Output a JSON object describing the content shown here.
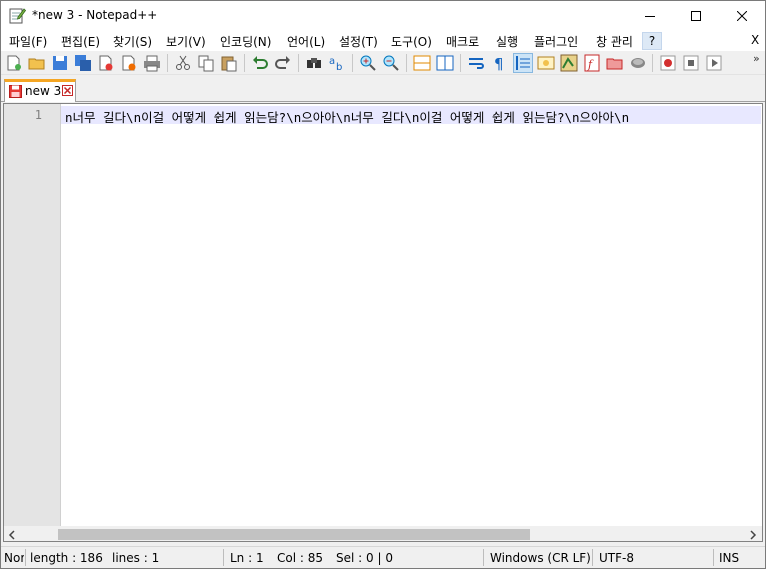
{
  "window": {
    "title": "*new 3 - Notepad++",
    "icon": "notepad-pencil-icon"
  },
  "menu": {
    "items": [
      "파일(F)",
      "편집(E)",
      "찾기(S)",
      "보기(V)",
      "인코딩(N)",
      "언어(L)",
      "설정(T)",
      "도구(O)",
      "매크로",
      "실행",
      "플러그인",
      "창 관리"
    ],
    "help": "?",
    "close": "X"
  },
  "toolbar": {
    "buttons": [
      "new-file-icon",
      "open-file-icon",
      "save-icon",
      "save-all-icon",
      "close-icon",
      "close-all-icon",
      "print-icon",
      "cut-icon",
      "copy-icon",
      "paste-icon",
      "undo-icon",
      "redo-icon",
      "find-icon",
      "replace-icon",
      "zoom-in-icon",
      "zoom-out-icon",
      "sync-vertical-icon",
      "sync-horizontal-icon",
      "word-wrap-icon",
      "show-all-chars-icon",
      "indent-guide-icon",
      "user-lang-icon",
      "doc-map-icon",
      "function-list-icon",
      "folder-workspace-icon",
      "monitor-icon",
      "record-macro-icon",
      "stop-macro-icon",
      "play-macro-icon"
    ],
    "more": "»"
  },
  "tab": {
    "label": "new 3",
    "icon": "unsaved-file-icon"
  },
  "editor": {
    "line_number": "1",
    "line_text": "n너무 길다\\n이걸 어떻게 쉽게 읽는담?\\n으아아\\n너무 길다\\n이걸 어떻게 쉽게 읽는담?\\n으아아\\n"
  },
  "status": {
    "type": "Nor",
    "length": "length : 186",
    "lines": "lines : 1",
    "ln": "Ln : 1",
    "col": "Col : 85",
    "sel": "Sel : 0 | 0",
    "eol": "Windows (CR LF)",
    "encoding": "UTF-8",
    "mode": "INS"
  }
}
